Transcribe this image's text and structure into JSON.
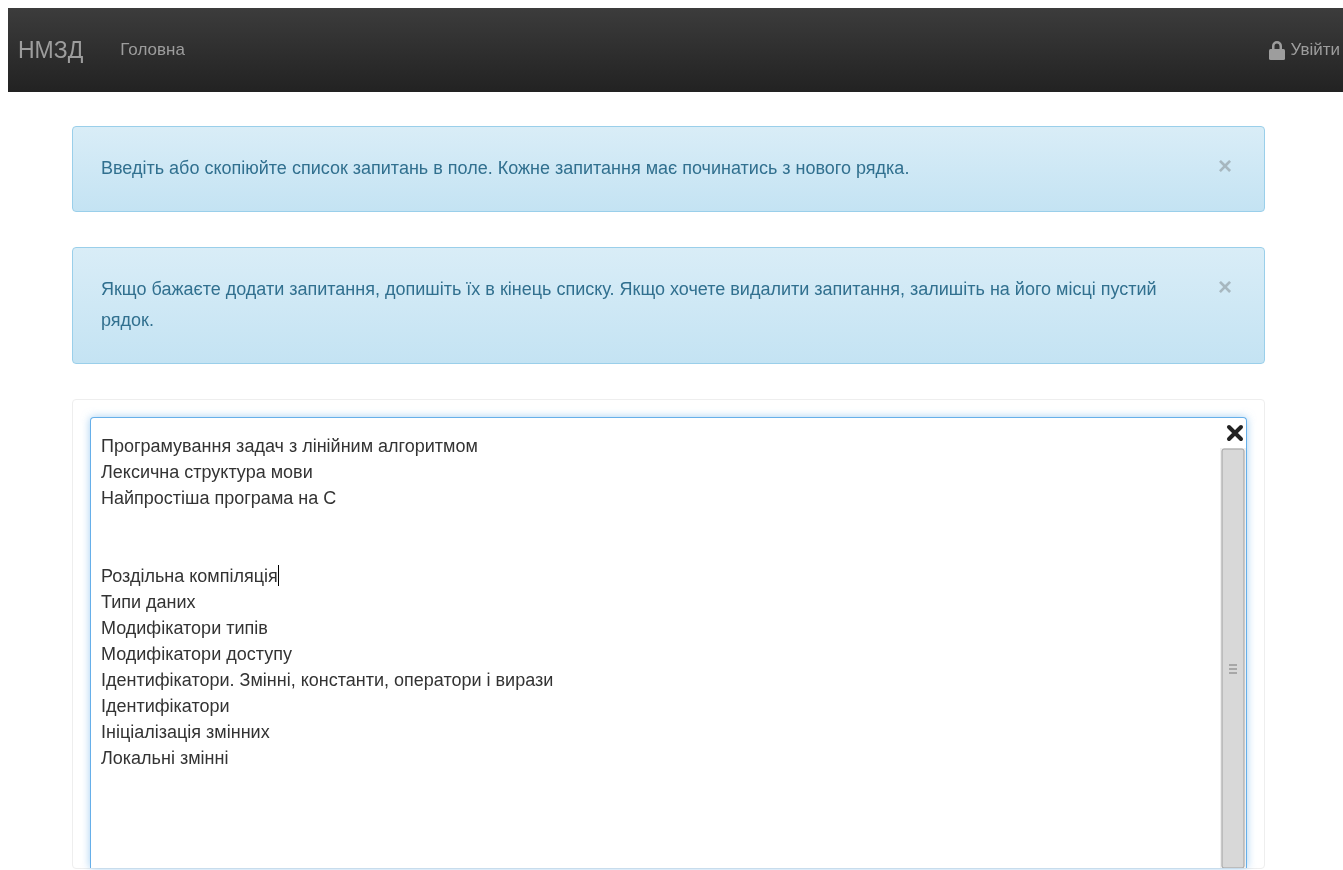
{
  "navbar": {
    "brand": "НМЗД",
    "links": [
      {
        "label": "Головна",
        "selected": false
      }
    ],
    "login": "Увійти"
  },
  "alerts": [
    {
      "text": "Введіть або скопіюйте список запитань в поле. Кожне запитання має починатись з нового рядка.",
      "close": "×"
    },
    {
      "text": "Якщо бажаєте додати запитання, допишіть їх в кінець списку. Якщо хочете видалити запитання, залишіть на його місці пустий рядок.",
      "close": "×"
    }
  ],
  "editor": {
    "lines": [
      {
        "kind": "text",
        "text": "Програмування задач з лінійним алгоритмом",
        "caret": false
      },
      {
        "kind": "text",
        "text": "Лексична структура мови",
        "caret": false
      },
      {
        "kind": "text",
        "text": "Найпростіша програма на С",
        "caret": false
      },
      {
        "kind": "blank"
      },
      {
        "kind": "blank"
      },
      {
        "kind": "text",
        "text": "Роздільна компіляція",
        "caret": true
      },
      {
        "kind": "text",
        "text": "Типи даних",
        "caret": false
      },
      {
        "kind": "text",
        "text": "Модифікатори типів",
        "caret": false
      },
      {
        "kind": "text",
        "text": "Модифікатори доступу",
        "caret": false
      },
      {
        "kind": "text",
        "text": "Ідентифікатори. Змінні, константи, оператори і вирази",
        "caret": false
      },
      {
        "kind": "text",
        "text": "Ідентифікатори",
        "caret": false
      },
      {
        "kind": "text",
        "text": "Ініціалізація змінних",
        "caret": false
      },
      {
        "kind": "text",
        "text": "Локальні змінні",
        "caret": false
      }
    ]
  }
}
